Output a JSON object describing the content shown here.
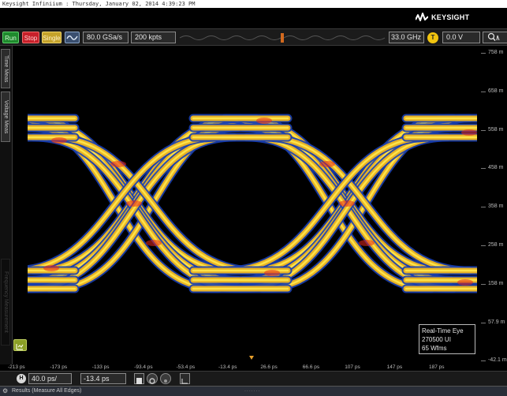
{
  "window": {
    "title": "Keysight Infiniium : Thursday, January 02, 2014 4:39:23 PM"
  },
  "brand": {
    "logo_text": "KEYSIGHT"
  },
  "toolbar": {
    "run_label": "Run",
    "stop_label": "Stop",
    "single_label": "Single",
    "sample_rate": "80.0 GSa/s",
    "memory_depth": "200 kpts",
    "bandwidth": "33.0 GHz",
    "trigger_badge": "T",
    "trigger_level": "0.0 V"
  },
  "side_tabs": {
    "time_meas": "Time Meas",
    "voltage_meas": "Voltage Meas",
    "hidden_tab": "Frequency Measurement"
  },
  "y_axis": {
    "labels": [
      "758 m",
      "658 m",
      "558 m",
      "458 m",
      "358 m",
      "258 m",
      "158 m",
      "57.9 m",
      "-42.1 m"
    ]
  },
  "x_axis": {
    "labels": [
      "-213 ps",
      "-173 ps",
      "-133 ps",
      "-93.4 ps",
      "-53.4 ps",
      "-13.4 ps",
      "26.6 ps",
      "66.6 ps",
      "107 ps",
      "147 ps",
      "187 ps"
    ]
  },
  "info_box": {
    "mode": "Real-Time Eye",
    "ui_count": "270500 UI",
    "waveforms": "65 Wfms"
  },
  "horizontal": {
    "badge": "H",
    "scale": "40.0 ps/",
    "position": "-13.4 ps"
  },
  "results": {
    "label": "Results  (Measure All Edges)"
  },
  "colors": {
    "trace_outer": "#1a3fb0",
    "trace_mid": "#f2b81f",
    "trace_core": "#ffe84d",
    "trace_hot": "#e8261e",
    "run_green": "#1f8a2d",
    "stop_red": "#c7202a",
    "single_yellow": "#c4a22a"
  },
  "icons": {
    "logo": "keysight-wave-icon",
    "waveform_button": "waveform-icon",
    "settings": "gear-icon"
  }
}
